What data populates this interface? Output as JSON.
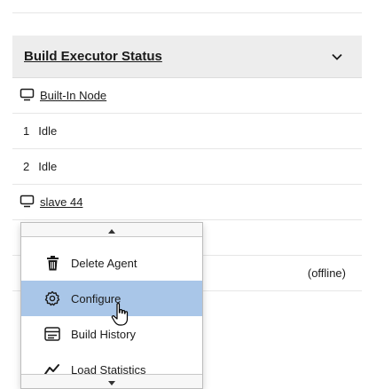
{
  "executor_panel": {
    "title": "Build Executor Status",
    "built_in_node": "Built-In Node",
    "executors": [
      {
        "number": "1",
        "status": "Idle"
      },
      {
        "number": "2",
        "status": "Idle"
      }
    ],
    "agent": {
      "name": "slave 44",
      "status": "(offline)"
    }
  },
  "context_menu": {
    "items": [
      {
        "label": "Delete Agent",
        "icon": "trash-icon"
      },
      {
        "label": "Configure",
        "icon": "gear-icon"
      },
      {
        "label": "Build History",
        "icon": "history-icon"
      },
      {
        "label": "Load Statistics",
        "icon": "chart-line-icon"
      }
    ],
    "active_item": "Configure"
  },
  "colors": {
    "header_bg": "#ededed",
    "menu_highlight": "#a9c6e8"
  }
}
